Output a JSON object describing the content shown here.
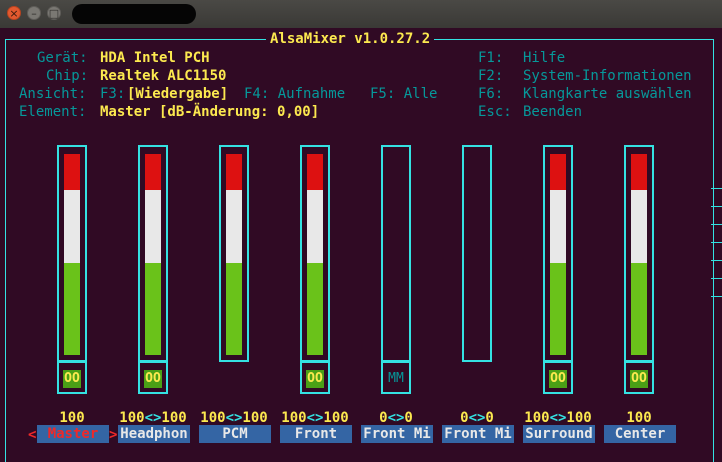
{
  "window": {
    "close_glyph": "×",
    "minimize_glyph": "–",
    "maximize_glyph": "□"
  },
  "title": "AlsaMixer v1.0.27.2",
  "info": {
    "geraet_label": "Gerät:",
    "geraet_value": "HDA Intel PCH",
    "chip_label": "Chip:",
    "chip_value": "Realtek ALC1150",
    "ansicht_label": "Ansicht:",
    "view_f3_key": "F3:",
    "view_f3_value": "[Wiedergabe]",
    "view_f4": "F4: Aufnahme",
    "view_f5": "F5: Alle",
    "element_label": "Element:",
    "element_value": "Master [dB-Änderung: 0,00]"
  },
  "help": [
    {
      "key": "F1:",
      "label": "Hilfe"
    },
    {
      "key": "F2:",
      "label": "System-Informationen"
    },
    {
      "key": "F6:",
      "label": "Klangkarte auswählen"
    },
    {
      "key": "Esc:",
      "label": "Beenden"
    }
  ],
  "channels": [
    {
      "name": "Master",
      "level_text": "100",
      "level_pct": 100,
      "mute": "OO",
      "muted": false,
      "selected": true
    },
    {
      "name": "Headphon",
      "level_text": "100<>100",
      "level_pct": 100,
      "mute": "OO",
      "muted": false,
      "selected": false
    },
    {
      "name": "PCM",
      "level_text": "100<>100",
      "level_pct": 100,
      "mute": "",
      "muted": false,
      "selected": false
    },
    {
      "name": "Front",
      "level_text": "100<>100",
      "level_pct": 100,
      "mute": "OO",
      "muted": false,
      "selected": false
    },
    {
      "name": "Front Mi",
      "level_text": "0<>0",
      "level_pct": 0,
      "mute": "MM",
      "muted": true,
      "selected": false
    },
    {
      "name": "Front Mi",
      "level_text": "0<>0",
      "level_pct": 0,
      "mute": "",
      "muted": false,
      "selected": false
    },
    {
      "name": "Surround",
      "level_text": "100<>100",
      "level_pct": 100,
      "mute": "OO",
      "muted": false,
      "selected": false
    },
    {
      "name": "Center",
      "level_text": "100",
      "level_pct": 100,
      "mute": "OO",
      "muted": false,
      "selected": false
    }
  ],
  "cursor": {
    "left": "<",
    "right": ">"
  },
  "colors": {
    "background": "#300a24",
    "frame": "#34e2e2",
    "label": "#06989a",
    "value": "#fce94f",
    "bar_red": "#dd1111",
    "bar_white": "#e8e8e8",
    "bar_green": "#6ac21a",
    "name_bg": "#3465a4",
    "selected_name": "#ef2929"
  }
}
